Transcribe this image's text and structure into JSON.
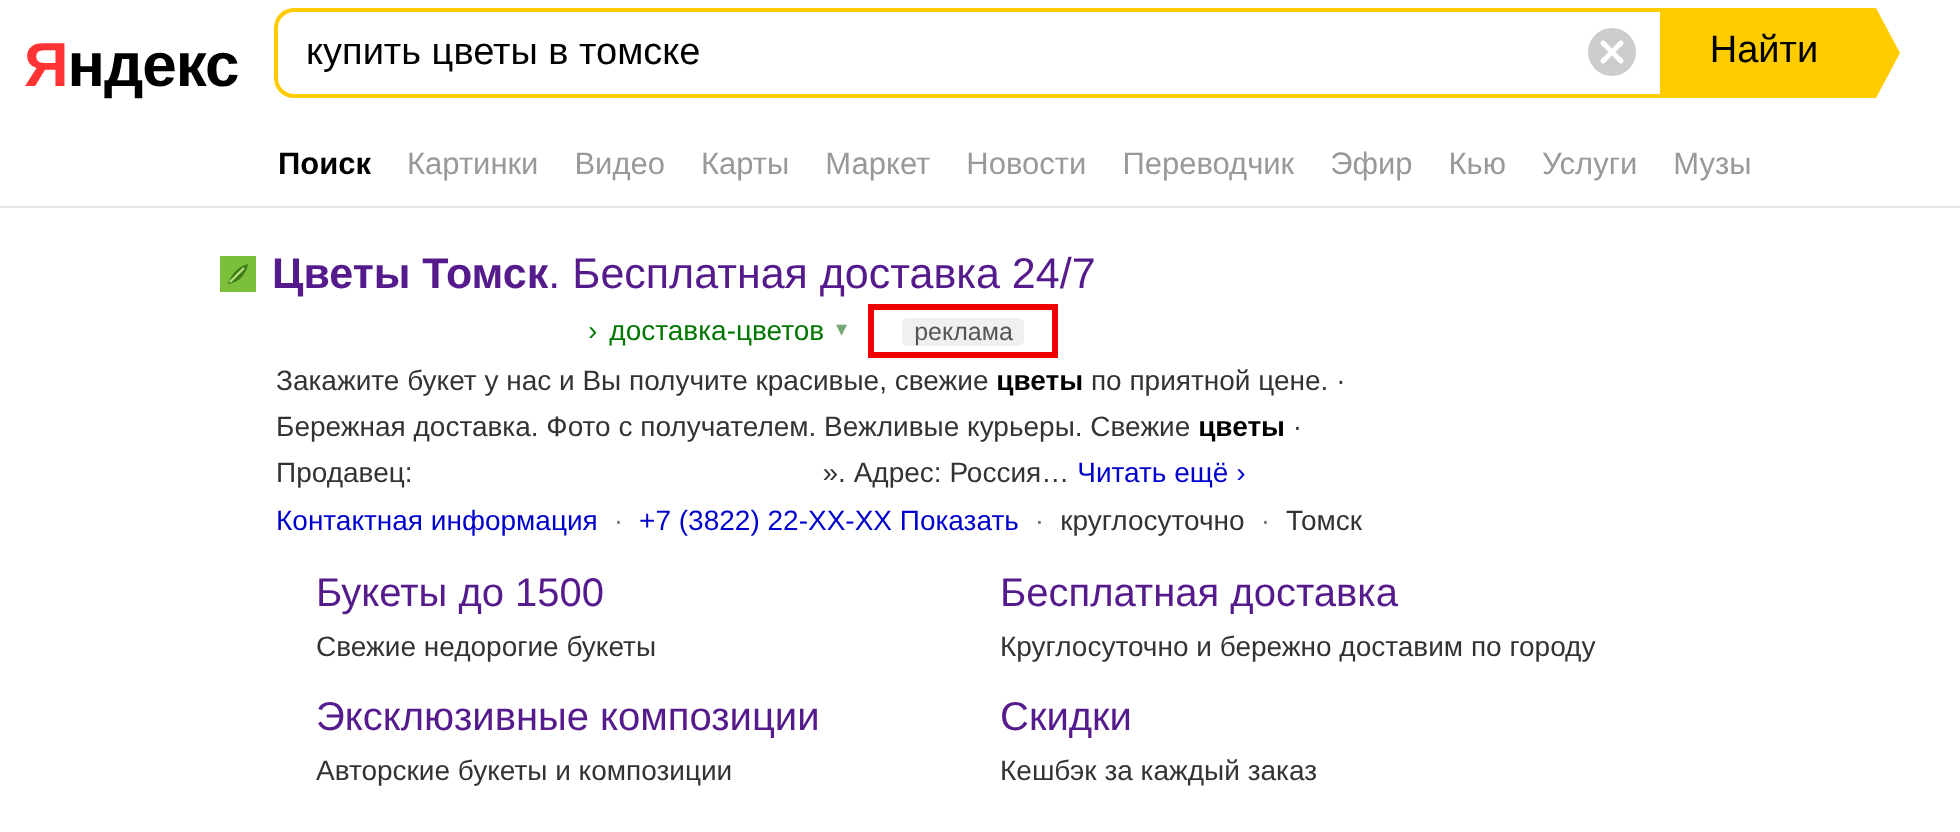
{
  "logo": "Яндекс",
  "search": {
    "value": "купить цветы в томске",
    "button": "Найти"
  },
  "tabs": [
    {
      "label": "Поиск",
      "selected": true
    },
    {
      "label": "Картинки",
      "selected": false
    },
    {
      "label": "Видео",
      "selected": false
    },
    {
      "label": "Карты",
      "selected": false
    },
    {
      "label": "Маркет",
      "selected": false
    },
    {
      "label": "Новости",
      "selected": false
    },
    {
      "label": "Переводчик",
      "selected": false
    },
    {
      "label": "Эфир",
      "selected": false
    },
    {
      "label": "Кью",
      "selected": false
    },
    {
      "label": "Услуги",
      "selected": false
    },
    {
      "label": "Музы",
      "selected": false
    }
  ],
  "result": {
    "title": "**Цветы Томск**. Бесплатная доставка 24/7",
    "url_separator": "›",
    "url_path": "доставка-цветов",
    "url_caret": "▾",
    "ad_label": "реклама",
    "snippet": "Закажите букет у нас и Вы получите красивые, свежие **цветы** по приятной цене. · Бережная доставка. Фото с получателем. Вежливые курьеры. Свежие **цветы** ·",
    "seller_label": "Продавец:",
    "seller_rest": "». Адрес: Россия…",
    "read_more": "Читать ещё",
    "read_more_caret": "›",
    "contact_separator": "·",
    "contacts": [
      {
        "text": "Контактная информация",
        "kind": "link"
      },
      {
        "text": "+7 (3822) 22-XX-XX Показать",
        "kind": "link"
      },
      {
        "text": "круглосуточно",
        "kind": "plain"
      },
      {
        "text": "Томск",
        "kind": "plain"
      }
    ],
    "sitelinks": [
      {
        "title": "Букеты до 1500",
        "description": "Свежие недорогие букеты"
      },
      {
        "title": "Бесплатная доставка",
        "description": "Круглосуточно и бережно доставим по городу"
      },
      {
        "title": "Эксклюзивные композиции",
        "description": "Авторские букеты и композиции"
      },
      {
        "title": "Скидки",
        "description": "Кешбэк за каждый заказ"
      }
    ]
  }
}
